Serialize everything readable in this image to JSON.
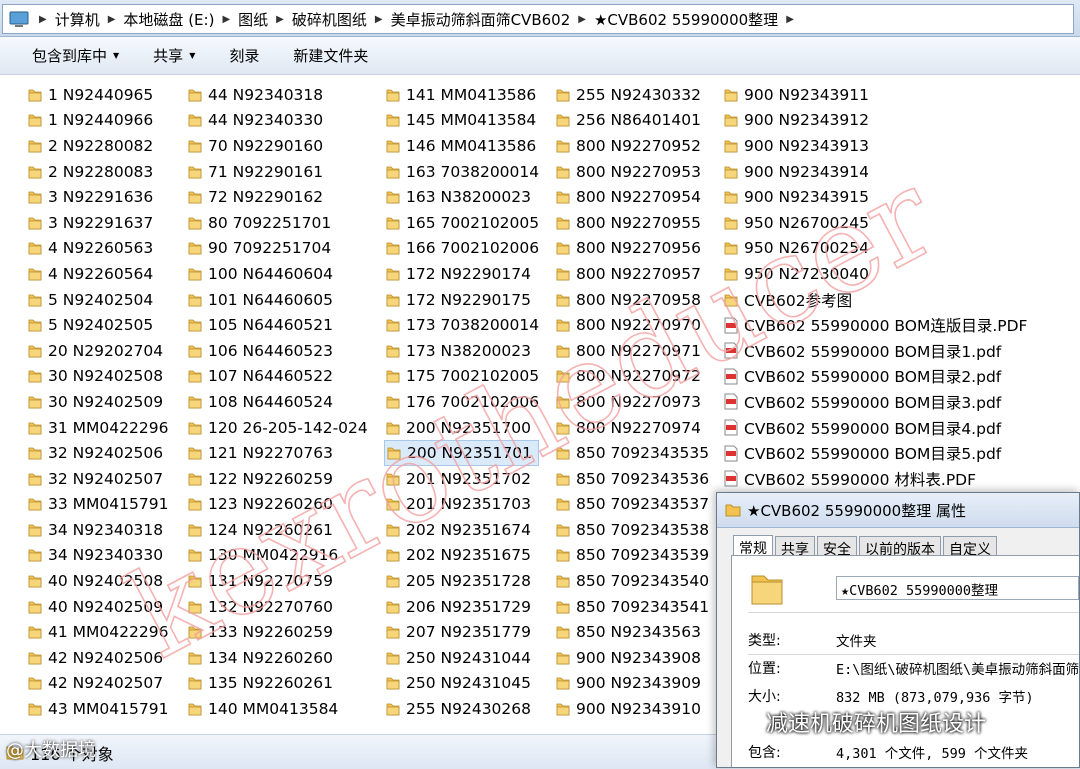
{
  "address": {
    "segments": [
      "计算机",
      "本地磁盘 (E:)",
      "图纸",
      "破碎机图纸",
      "美卓振动筛斜面筛CVB602",
      "★CVB602 55990000整理"
    ]
  },
  "toolbar": {
    "include_label": "包含到库中",
    "share_label": "共享",
    "burn_label": "刻录",
    "new_folder_label": "新建文件夹"
  },
  "files": {
    "col1": [
      "1  N92440965",
      "1  N92440966",
      "2  N92280082",
      "2  N92280083",
      "3  N92291636",
      "3  N92291637",
      "4  N92260563",
      "4  N92260564",
      "5  N92402504",
      "5  N92402505",
      "20  N29202704",
      "30  N92402508",
      "30  N92402509",
      "31  MM0422296",
      "32  N92402506",
      "32  N92402507",
      "33  MM0415791",
      "34  N92340318",
      "34  N92340330",
      "40  N92402508",
      "40  N92402509",
      "41  MM0422296",
      "42  N92402506",
      "42  N92402507",
      "43  MM0415791"
    ],
    "col2": [
      "44  N92340318",
      "44  N92340330",
      "70  N92290160",
      "71  N92290161",
      "72  N92290162",
      "80  7092251701",
      "90  7092251704",
      "100  N64460604",
      "101  N64460605",
      "105  N64460521",
      "106  N64460523",
      "107  N64460522",
      "108  N64460524",
      "120  26-205-142-024",
      "121  N92270763",
      "122  N92260259",
      "123  N92260260",
      "124  N92260261",
      "130  MM0422916",
      "131  N92270759",
      "132  N92270760",
      "133  N92260259",
      "134  N92260260",
      "135  N92260261",
      "140  MM0413584"
    ],
    "col3": [
      "141  MM0413586",
      "145  MM0413584",
      "146  MM0413586",
      "163  7038200014",
      "163  N38200023",
      "165  7002102005",
      "166  7002102006",
      "172  N92290174",
      "172  N92290175",
      "173  7038200014",
      "173  N38200023",
      "175  7002102005",
      "176  7002102006",
      "200  N92351700",
      "200  N92351701",
      "201  N92351702",
      "201  N92351703",
      "202  N92351674",
      "202  N92351675",
      "205  N92351728",
      "206  N92351729",
      "207  N92351779",
      "250  N92431044",
      "250  N92431045",
      "255  N92430268"
    ],
    "col4": [
      "255  N92430332",
      "256  N86401401",
      "800  N92270952",
      "800  N92270953",
      "800  N92270954",
      "800  N92270955",
      "800  N92270956",
      "800  N92270957",
      "800  N92270958",
      "800  N92270970",
      "800  N92270971",
      "800  N92270972",
      "800  N92270973",
      "800  N92270974",
      "850  7092343535",
      "850  7092343536",
      "850  7092343537",
      "850  7092343538",
      "850  7092343539",
      "850  7092343540",
      "850  7092343541",
      "850  N92343563",
      "900  N92343908",
      "900  N92343909",
      "900  N92343910"
    ],
    "col5_folders": [
      "900  N92343911",
      "900  N92343912",
      "900  N92343913",
      "900  N92343914",
      "900  N92343915",
      "950  N26700245",
      "950  N26700254",
      "950  N27230040",
      "CVB602参考图"
    ],
    "col5_pdfs": [
      "CVB602 55990000 BOM连版目录.PDF",
      "CVB602 55990000 BOM目录1.pdf",
      "CVB602 55990000 BOM目录2.pdf",
      "CVB602 55990000 BOM目录3.pdf",
      "CVB602 55990000 BOM目录4.pdf",
      "CVB602 55990000 BOM目录5.pdf",
      "CVB602 55990000 材料表.PDF"
    ]
  },
  "status": {
    "count": "116 个对象"
  },
  "watermark": "kexrotheducer",
  "dialog": {
    "title": "★CVB602 55990000整理 属性",
    "tabs": [
      "常规",
      "共享",
      "安全",
      "以前的版本",
      "自定义"
    ],
    "name": "★CVB602 55990000整理",
    "type_label": "类型:",
    "type_value": "文件夹",
    "location_label": "位置:",
    "location_value": "E:\\图纸\\破碎机图纸\\美卓振动筛斜面筛",
    "size_label": "大小:",
    "size_value": "832 MB (873,079,936 字节)",
    "contains_label": "包含:",
    "contains_value": "4,301 个文件, 599 个文件夹"
  },
  "credit": {
    "wechat": "减速机破碎机图纸设计",
    "corner": "@大数据境"
  },
  "colors": {
    "folder": "#f2c14e",
    "accent": "#cfdcee",
    "watermark": "#f08080"
  }
}
